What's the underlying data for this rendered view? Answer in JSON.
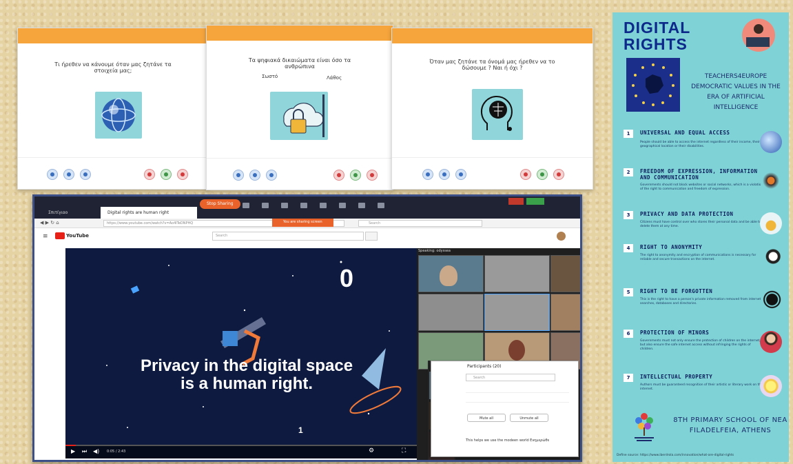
{
  "quiz_cards": [
    {
      "question": "Τι ήρεθεν να κάνουμε όταν μας ζητάνε τα στοιχεία μας;",
      "image_icon": "globe-icon"
    },
    {
      "question": "Τα ψηφιακά δικαιώματα είναι όσο τα ανθρώπινα",
      "option_true": "Σωστό",
      "option_false": "Λάθος",
      "image_icon": "lock-cloud-icon"
    },
    {
      "question": "Όταν μας ζητάνε τα όνομά μας ήρεθεν να το δώσουμε ? Ναι ή όχι ?",
      "image_icon": "brain-head-icon"
    }
  ],
  "browser": {
    "active_tab": "Digital rights are human right",
    "other_tab": "Σπιτίγιαο",
    "url": "https://www.youtube.com/watch?v=Ao4lTeDNPHQ",
    "stop_sharing": "Stop Sharing",
    "sharing_notice": "You are sharing screen",
    "youtube_logo": "YouTube",
    "search_placeholder": "Search",
    "speaking_label": "Speaking: ",
    "speaking_name": "odyssea",
    "video_caption_line1": "Privacy in the digital space",
    "video_caption_line2": "is a human right.",
    "video_time": "0:05 / 2:43",
    "participants_title": "Participants (20)",
    "participants_search": "Search",
    "mute_all": "Mute all",
    "unmute_all": "Unmute all",
    "chat_message": "This helps we use the modeen world Ενημερώθε"
  },
  "poster": {
    "title_line1": "DIGITAL",
    "title_line2": "RIGHTS",
    "subtitle": "TEACHERS4EUROPE DEMOCRATIC VALUES IN THE ERA OF ARTIFICIAL INTELLIGENCE",
    "rights": [
      {
        "num": "1",
        "title": "UNIVERSAL AND EQUAL ACCESS",
        "desc": "People should be able to access the internet regardless of their income, their geographical location or their disabilities."
      },
      {
        "num": "2",
        "title": "FREEDOM OF EXPRESSION, INFORMATION AND COMMUNICATION",
        "desc": "Governments should not block websites or social networks, which is a violation of the right to communication and freedom of expression."
      },
      {
        "num": "3",
        "title": "PRIVACY AND DATA PROTECTION",
        "desc": "Citizens must have control over who stores their personal data and be able to delete them at any time."
      },
      {
        "num": "4",
        "title": "RIGHT TO ANONYMITY",
        "desc": "The right to anonymity and encryption of communications is necessary for reliable and secure transactions on the internet."
      },
      {
        "num": "5",
        "title": "RIGHT TO BE FORGOTTEN",
        "desc": "This is the right to have a person's private information removed from internet searches, databases and directories."
      },
      {
        "num": "6",
        "title": "PROTECTION OF MINORS",
        "desc": "Governments must not only ensure the protection of children on the internet, but also ensure the safe internet access without infringing the rights of children."
      },
      {
        "num": "7",
        "title": "INTELLECTUAL PROPERTY",
        "desc": "Authors must be guaranteed recognition of their artistic or literary work on the internet."
      }
    ],
    "school": "8TH PRIMARY SCHOOL OF NEA FILADELFEIA, ATHENS",
    "source": "Define source: https://www.iberdrola.com/innovation/what-are-digital-rights"
  },
  "colors": {
    "quiz_bar": "#f6a53c",
    "poster_bg": "#7fd3d7",
    "poster_title": "#0d2a8a",
    "video_bg": "#0e1a3f",
    "stop_sharing": "#e8622a"
  }
}
